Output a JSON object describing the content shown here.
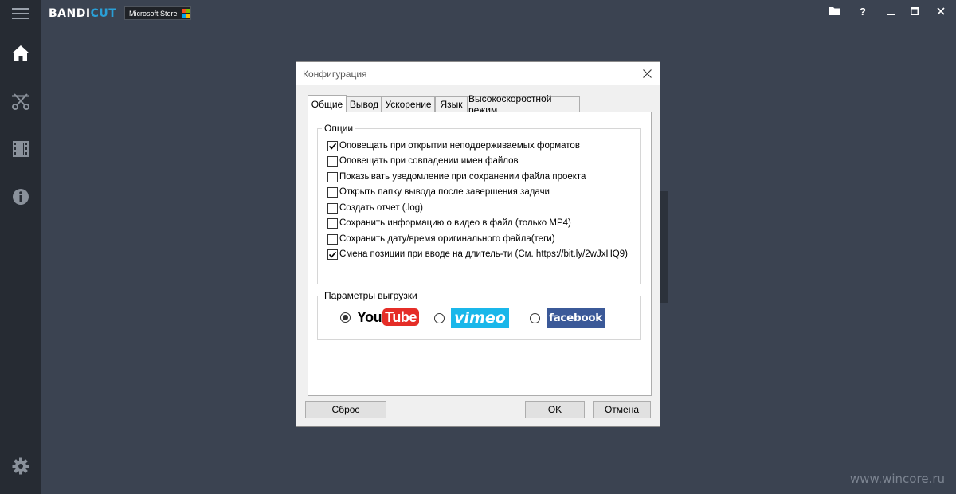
{
  "app": {
    "logo_part1": "BANDI",
    "logo_part2": "CUT",
    "store_badge": "Microsoft Store",
    "colors": {
      "background": "#3b4351",
      "sidebar": "#262b33",
      "accent": "#2a9fd6"
    }
  },
  "sidebar": {
    "items": [
      {
        "icon": "home-icon"
      },
      {
        "icon": "cut-icon"
      },
      {
        "icon": "film-icon"
      },
      {
        "icon": "info-icon"
      }
    ],
    "settings_icon": "gear-icon"
  },
  "window_controls": [
    "folder-icon",
    "help-icon",
    "minimize-icon",
    "maximize-icon",
    "close-icon"
  ],
  "dialog": {
    "title": "Конфигурация",
    "tabs": [
      {
        "label": "Общие",
        "active": true
      },
      {
        "label": "Вывод",
        "active": false
      },
      {
        "label": "Ускорение",
        "active": false
      },
      {
        "label": "Язык",
        "active": false
      },
      {
        "label": "Высокоскоростной режим",
        "active": false
      }
    ],
    "options_group": {
      "legend": "Опции",
      "items": [
        {
          "label": "Оповещать при открытии неподдерживаемых форматов",
          "checked": true
        },
        {
          "label": "Оповещать при совпадении имен файлов",
          "checked": false
        },
        {
          "label": "Показывать уведомление при сохранении файла проекта",
          "checked": false
        },
        {
          "label": "Открыть папку вывода после завершения задачи",
          "checked": false
        },
        {
          "label": "Создать отчет (.log)",
          "checked": false
        },
        {
          "label": "Сохранить информацию о видео в файл (только MP4)",
          "checked": false
        },
        {
          "label": "Сохранить дату/время оригинального файла(теги)",
          "checked": false
        },
        {
          "label": "Смена позиции при вводе на длитель-ти (См. https://bit.ly/2wJxHQ9)",
          "checked": true
        }
      ]
    },
    "upload_group": {
      "legend": "Параметры выгрузки",
      "options": [
        {
          "service": "YouTube",
          "logo_you": "You",
          "logo_tube": "Tube",
          "selected": true
        },
        {
          "service": "Vimeo",
          "logo_text": "vimeo",
          "selected": false
        },
        {
          "service": "Facebook",
          "logo_text": "facebook",
          "selected": false
        }
      ]
    },
    "buttons": {
      "reset": "Сброс",
      "ok": "OK",
      "cancel": "Отмена"
    }
  },
  "watermark": "www.wincore.ru"
}
